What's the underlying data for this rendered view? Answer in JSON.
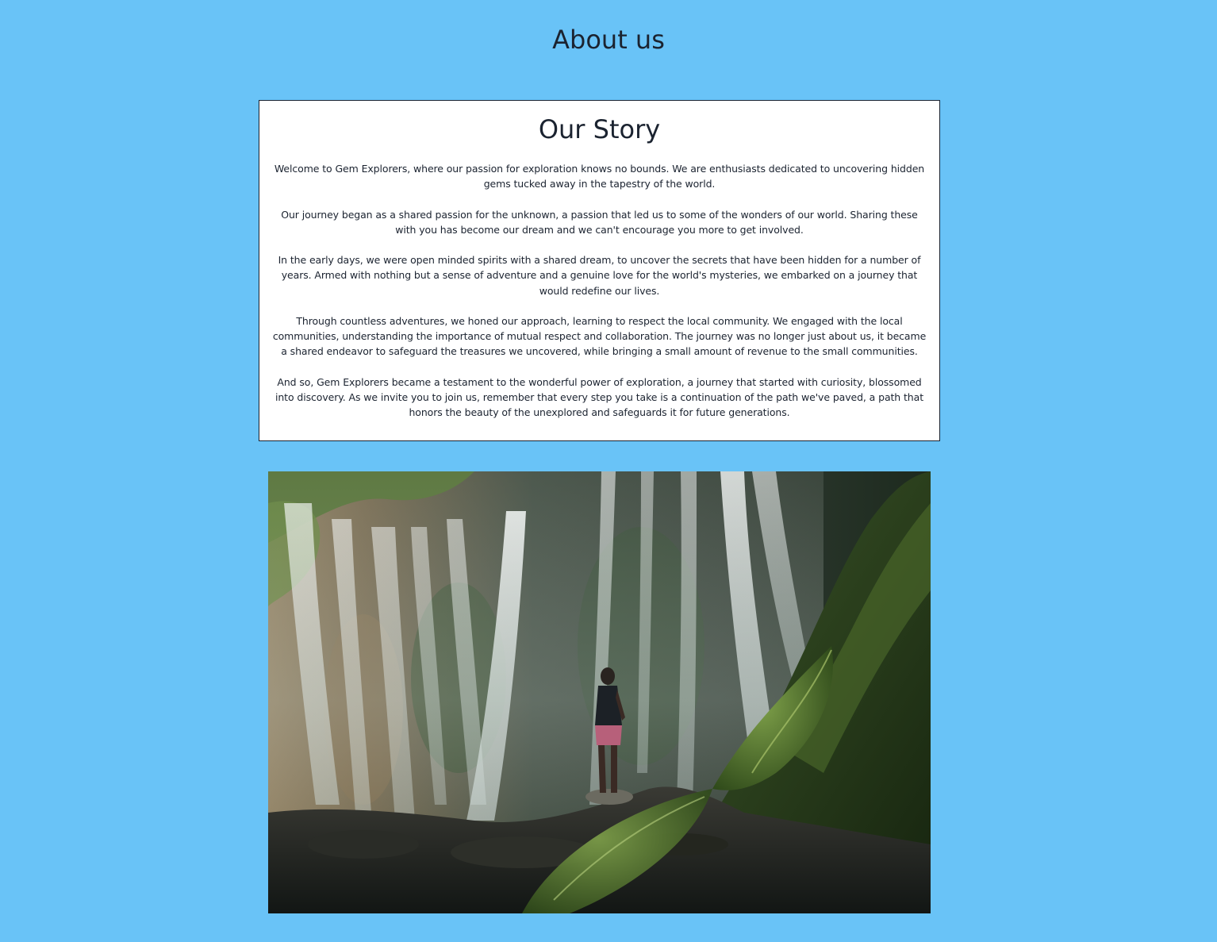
{
  "page": {
    "title": "About us",
    "background_color": "#69c3f7"
  },
  "story": {
    "heading": "Our Story",
    "paragraphs": [
      "Welcome to Gem Explorers, where our passion for exploration knows no bounds. We are enthusiasts dedicated to uncovering hidden gems tucked away in the tapestry of the world.",
      "Our journey began as a shared passion for the unknown, a passion that led us to some of the wonders of our world. Sharing these with you has become our dream and we can't encourage you more to get involved.",
      "In the early days, we were open minded spirits with a shared dream, to uncover the secrets that have been hidden for a number of years. Armed with nothing but a sense of adventure and a genuine love for the world's mysteries, we embarked on a journey that would redefine our lives.",
      "Through countless adventures, we honed our approach, learning to respect the local community. We engaged with the local communities, understanding the importance of mutual respect and collaboration. The journey was no longer just about us, it became a shared endeavor to safeguard the treasures we uncovered, while bringing a small amount of revenue to the small communities.",
      "And so, Gem Explorers became a testament to the wonderful power of exploration, a journey that started with curiosity, blossomed into discovery. As we invite you to join us, remember that every step you take is a continuation of the path we've paved, a path that honors the beauty of the unexplored and safeguards it for future generations."
    ]
  },
  "photo": {
    "subject": "man-standing-before-waterfall"
  }
}
